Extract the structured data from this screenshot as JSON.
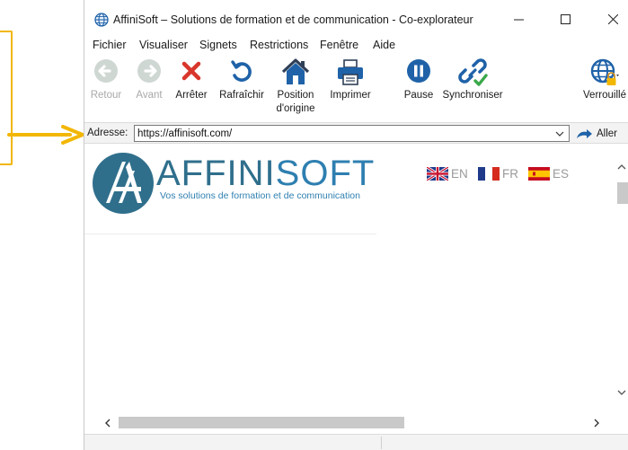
{
  "window": {
    "title": "AffiniSoft – Solutions de formation et de communication - Co-explorateur"
  },
  "menu": [
    "Fichier",
    "Visualiser",
    "Signets",
    "Restrictions",
    "Fenêtre",
    "Aide"
  ],
  "toolbar": {
    "back": "Retour",
    "forward": "Avant",
    "stop": "Arrêter",
    "refresh": "Rafraîchir",
    "home_line1": "Position",
    "home_line2": "d'origine",
    "print": "Imprimer",
    "pause": "Pause",
    "sync": "Synchroniser",
    "lock": "Verrouillé"
  },
  "address": {
    "label": "Adresse:",
    "value": "https://affinisoft.com/",
    "go": "Aller"
  },
  "page": {
    "brand_part1": "AFFINI",
    "brand_part2": "SOFT",
    "tagline": "Vos solutions de formation et de communication",
    "languages": [
      "EN",
      "FR",
      "ES"
    ]
  },
  "colors": {
    "accent_arrow": "#f2b705",
    "brand_dark": "#2f6f8c",
    "brand_light": "#2e7fb0",
    "stop_red": "#d9362b",
    "toolbar_blue": "#1f62a8"
  },
  "icons": [
    "globe-icon",
    "back-icon",
    "forward-icon",
    "stop-icon",
    "refresh-icon",
    "home-icon",
    "printer-icon",
    "pause-icon",
    "sync-icon",
    "lock-globe-icon",
    "go-arrow-icon"
  ]
}
